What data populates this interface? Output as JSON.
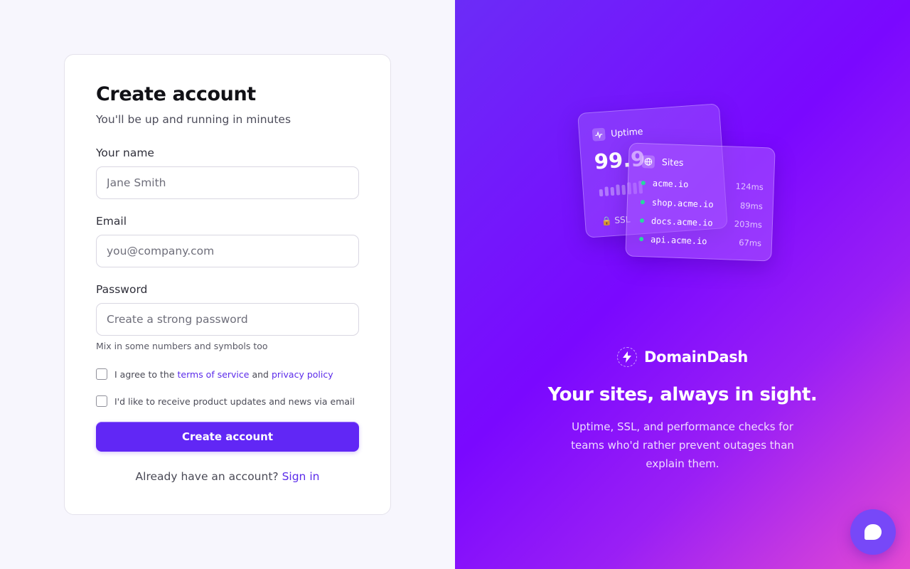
{
  "form": {
    "title": "Create account",
    "subtitle": "You'll be up and running in minutes",
    "name_label": "Your name",
    "name_placeholder": "Jane Smith",
    "email_label": "Email",
    "email_placeholder": "you@company.com",
    "password_label": "Password",
    "password_placeholder": "Create a strong password",
    "password_hint": "Mix in some numbers and symbols too",
    "terms_prefix": "I agree to the",
    "terms_link": "terms of service",
    "terms_and": "and",
    "privacy_link": "privacy policy",
    "updates_label": "I'd like to receive product updates and news via email",
    "submit_label": "Create account",
    "signin_prompt": "Already have an account?",
    "signin_link": "Sign in"
  },
  "hero": {
    "uptime_card": {
      "title": "Uptime",
      "value": "99.9",
      "ssl_label": "SSL"
    },
    "sites_card": {
      "title": "Sites",
      "sites": [
        {
          "host": "acme.io",
          "latency": "124ms"
        },
        {
          "host": "shop.acme.io",
          "latency": "89ms"
        },
        {
          "host": "docs.acme.io",
          "latency": "203ms"
        },
        {
          "host": "api.acme.io",
          "latency": "67ms"
        }
      ]
    },
    "brand_name": "DomainDash",
    "headline": "Your sites, always in sight.",
    "tagline": "Uptime, SSL, and performance checks for teams who'd rather prevent outages than explain them."
  },
  "colors": {
    "accent": "#6127f5",
    "link": "#5b2bea",
    "status_up": "#27d89f"
  },
  "icons": {
    "uptime": "activity-icon",
    "sites": "globe-icon",
    "ssl": "lock-icon",
    "brand": "lightning-icon",
    "chat": "chat-bubble-icon"
  }
}
